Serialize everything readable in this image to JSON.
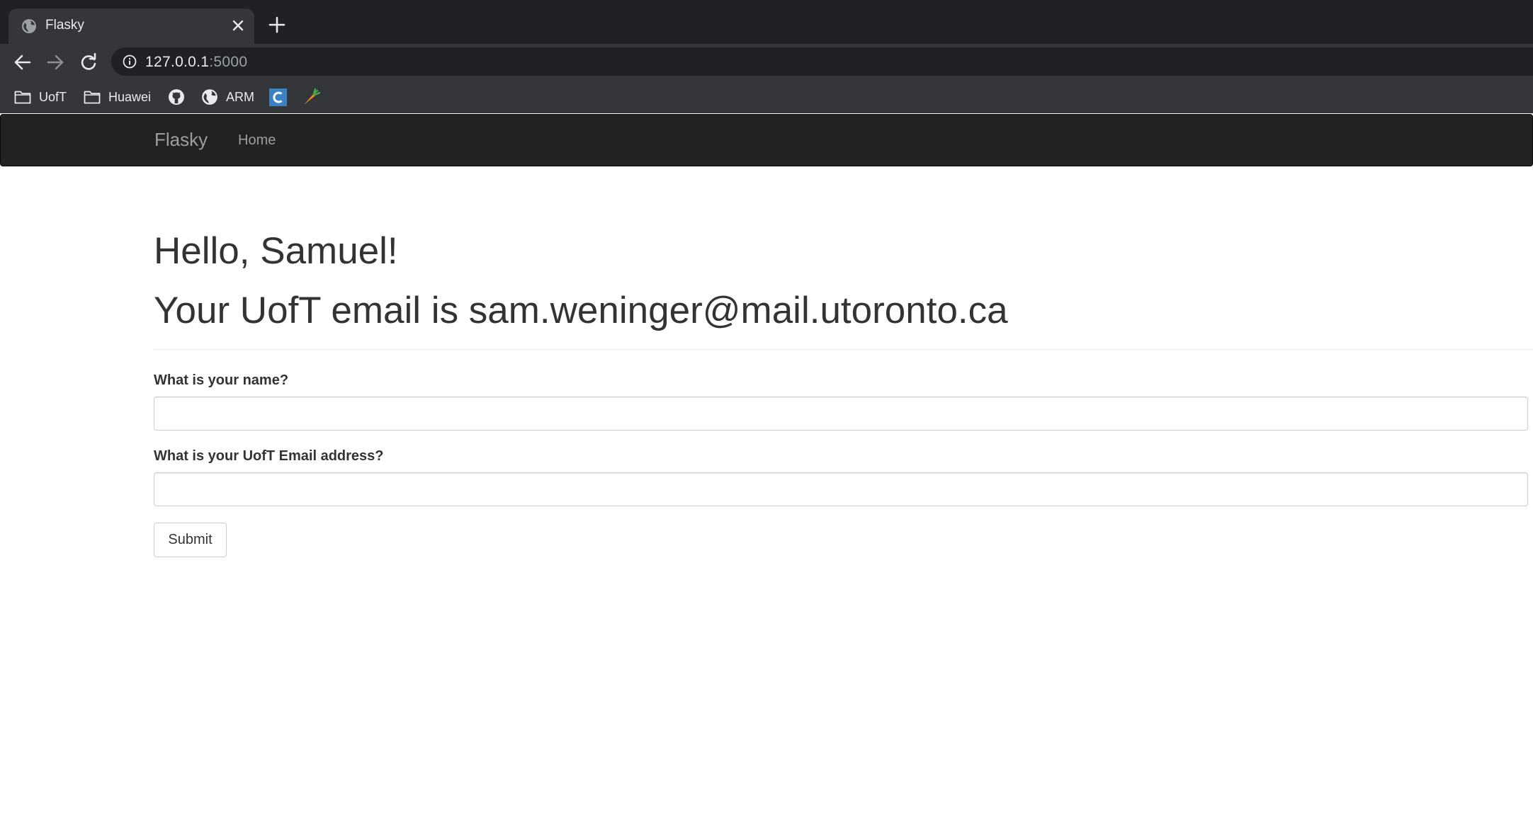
{
  "browser": {
    "tab": {
      "title": "Flasky"
    },
    "address": {
      "host": "127.0.0.1",
      "port": ":5000"
    },
    "bookmarks": [
      {
        "label": "UofT",
        "icon": "folder-icon"
      },
      {
        "label": "Huawei",
        "icon": "folder-icon"
      },
      {
        "label": "",
        "icon": "github-icon"
      },
      {
        "label": "ARM",
        "icon": "globe-icon"
      },
      {
        "label": "",
        "icon": "c-app-icon"
      },
      {
        "label": "",
        "icon": "carrot-icon"
      }
    ]
  },
  "navbar": {
    "brand": "Flasky",
    "home": "Home"
  },
  "page": {
    "greeting": "Hello, Samuel!",
    "email_line": "Your UofT email is sam.weninger@mail.utoronto.ca"
  },
  "form": {
    "name_label": "What is your name?",
    "name_value": "",
    "email_label": "What is your UofT Email address?",
    "email_value": "",
    "submit_label": "Submit"
  },
  "colors": {
    "navbar_bg": "#222222",
    "navbar_text": "#9d9d9d",
    "heading_text": "#333333",
    "chrome_dark": "#202124",
    "chrome_toolbar": "#35363a"
  }
}
